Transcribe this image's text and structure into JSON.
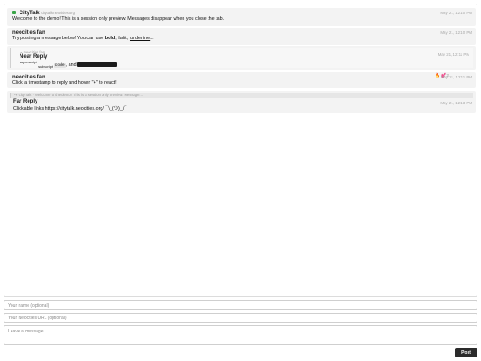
{
  "messages": [
    {
      "name": "CityTalk",
      "site": "citytalk.neocities.org",
      "time": "May 21, 12:10 PM",
      "text": "Welcome to the demo! This is a session only preview. Messages disappear when you close the tab."
    },
    {
      "name": "neocities fan",
      "time": "May 21, 12:10 PM",
      "text_before": "Try posting a message below! You can use ",
      "bold": "bold",
      "sep1": ", ",
      "italic": "italic",
      "sep2": ", ",
      "underline": "underline",
      "text_after": "..."
    },
    {
      "reply_to": "↪ neocities fan",
      "name": "Near Reply",
      "time": "May 21, 12:11 PM",
      "sup": "superscript",
      "sub": "subscript",
      "code": "code",
      "mid": ", and"
    },
    {
      "name": "neocities fan",
      "time": "May 21, 12:11 PM",
      "reactions": "🔥 💕",
      "reaction_count": "2",
      "text": "Click a timestamp to reply and hover \"+\" to react!"
    },
    {
      "quote": "↪ CityTalk · Welcome to the demo! This is a session only preview. Message...",
      "name": "Far Reply",
      "time": "May 21, 12:13 PM",
      "text_before": "Clickable links ",
      "link": "https://citytalk.neocities.org/",
      "text_after": " ¯\\_(ツ)_/¯"
    }
  ],
  "form": {
    "name_placeholder": "Your name (optional)",
    "url_placeholder": "Your Neocities URL (optional)",
    "message_placeholder": "Leave a message...",
    "post_label": "Post"
  }
}
